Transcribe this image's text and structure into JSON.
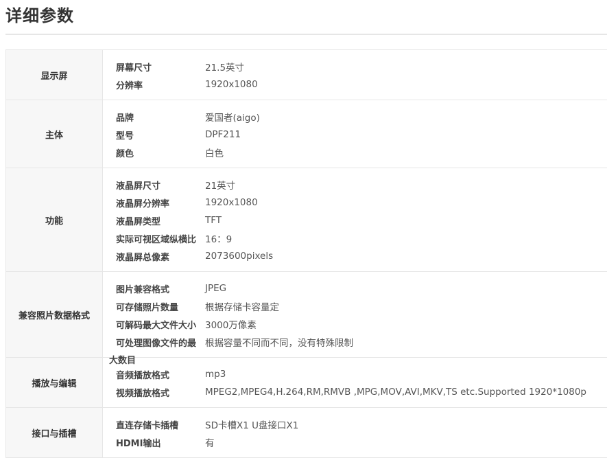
{
  "page": {
    "title": "详细参数"
  },
  "groups": [
    {
      "name": "显示屏",
      "items": [
        {
          "key": "屏幕尺寸",
          "value": "21.5英寸"
        },
        {
          "key": "分辨率",
          "value": "1920x1080"
        }
      ]
    },
    {
      "name": "主体",
      "items": [
        {
          "key": "品牌",
          "value": "爱国者(aigo)"
        },
        {
          "key": "型号",
          "value": "DPF211"
        },
        {
          "key": "颜色",
          "value": "白色"
        }
      ]
    },
    {
      "name": "功能",
      "items": [
        {
          "key": "液晶屏尺寸",
          "value": "21英寸"
        },
        {
          "key": "液晶屏分辨率",
          "value": "1920x1080"
        },
        {
          "key": "液晶屏类型",
          "value": "TFT"
        },
        {
          "key": "实际可视区域纵横比",
          "value": "16：9"
        },
        {
          "key": "液晶屏总像素",
          "value": "2073600pixels"
        }
      ]
    },
    {
      "name": "兼容照片数据格式",
      "items": [
        {
          "key": "图片兼容格式",
          "value": "JPEG"
        },
        {
          "key": "可存储照片数量",
          "value": "根据存储卡容量定"
        },
        {
          "key": "可解码最大文件大小",
          "value": "3000万像素"
        },
        {
          "key": "可处理图像文件的最",
          "value": "根据容量不同而不同，没有特殊限制"
        }
      ],
      "overflow_key": "大数目"
    },
    {
      "name": "播放与编辑",
      "items": [
        {
          "key": "音频播放格式",
          "value": "mp3"
        },
        {
          "key": "视频播放格式",
          "value": "MPEG2,MPEG4,H.264,RM,RMVB ,MPG,MOV,AVI,MKV,TS etc.Supported 1920*1080p"
        }
      ]
    },
    {
      "name": "接口与插槽",
      "items": [
        {
          "key": "直连存储卡插槽",
          "value": "SD卡槽X1 U盘接口X1"
        },
        {
          "key": "HDMI输出",
          "value": "有"
        }
      ]
    }
  ]
}
